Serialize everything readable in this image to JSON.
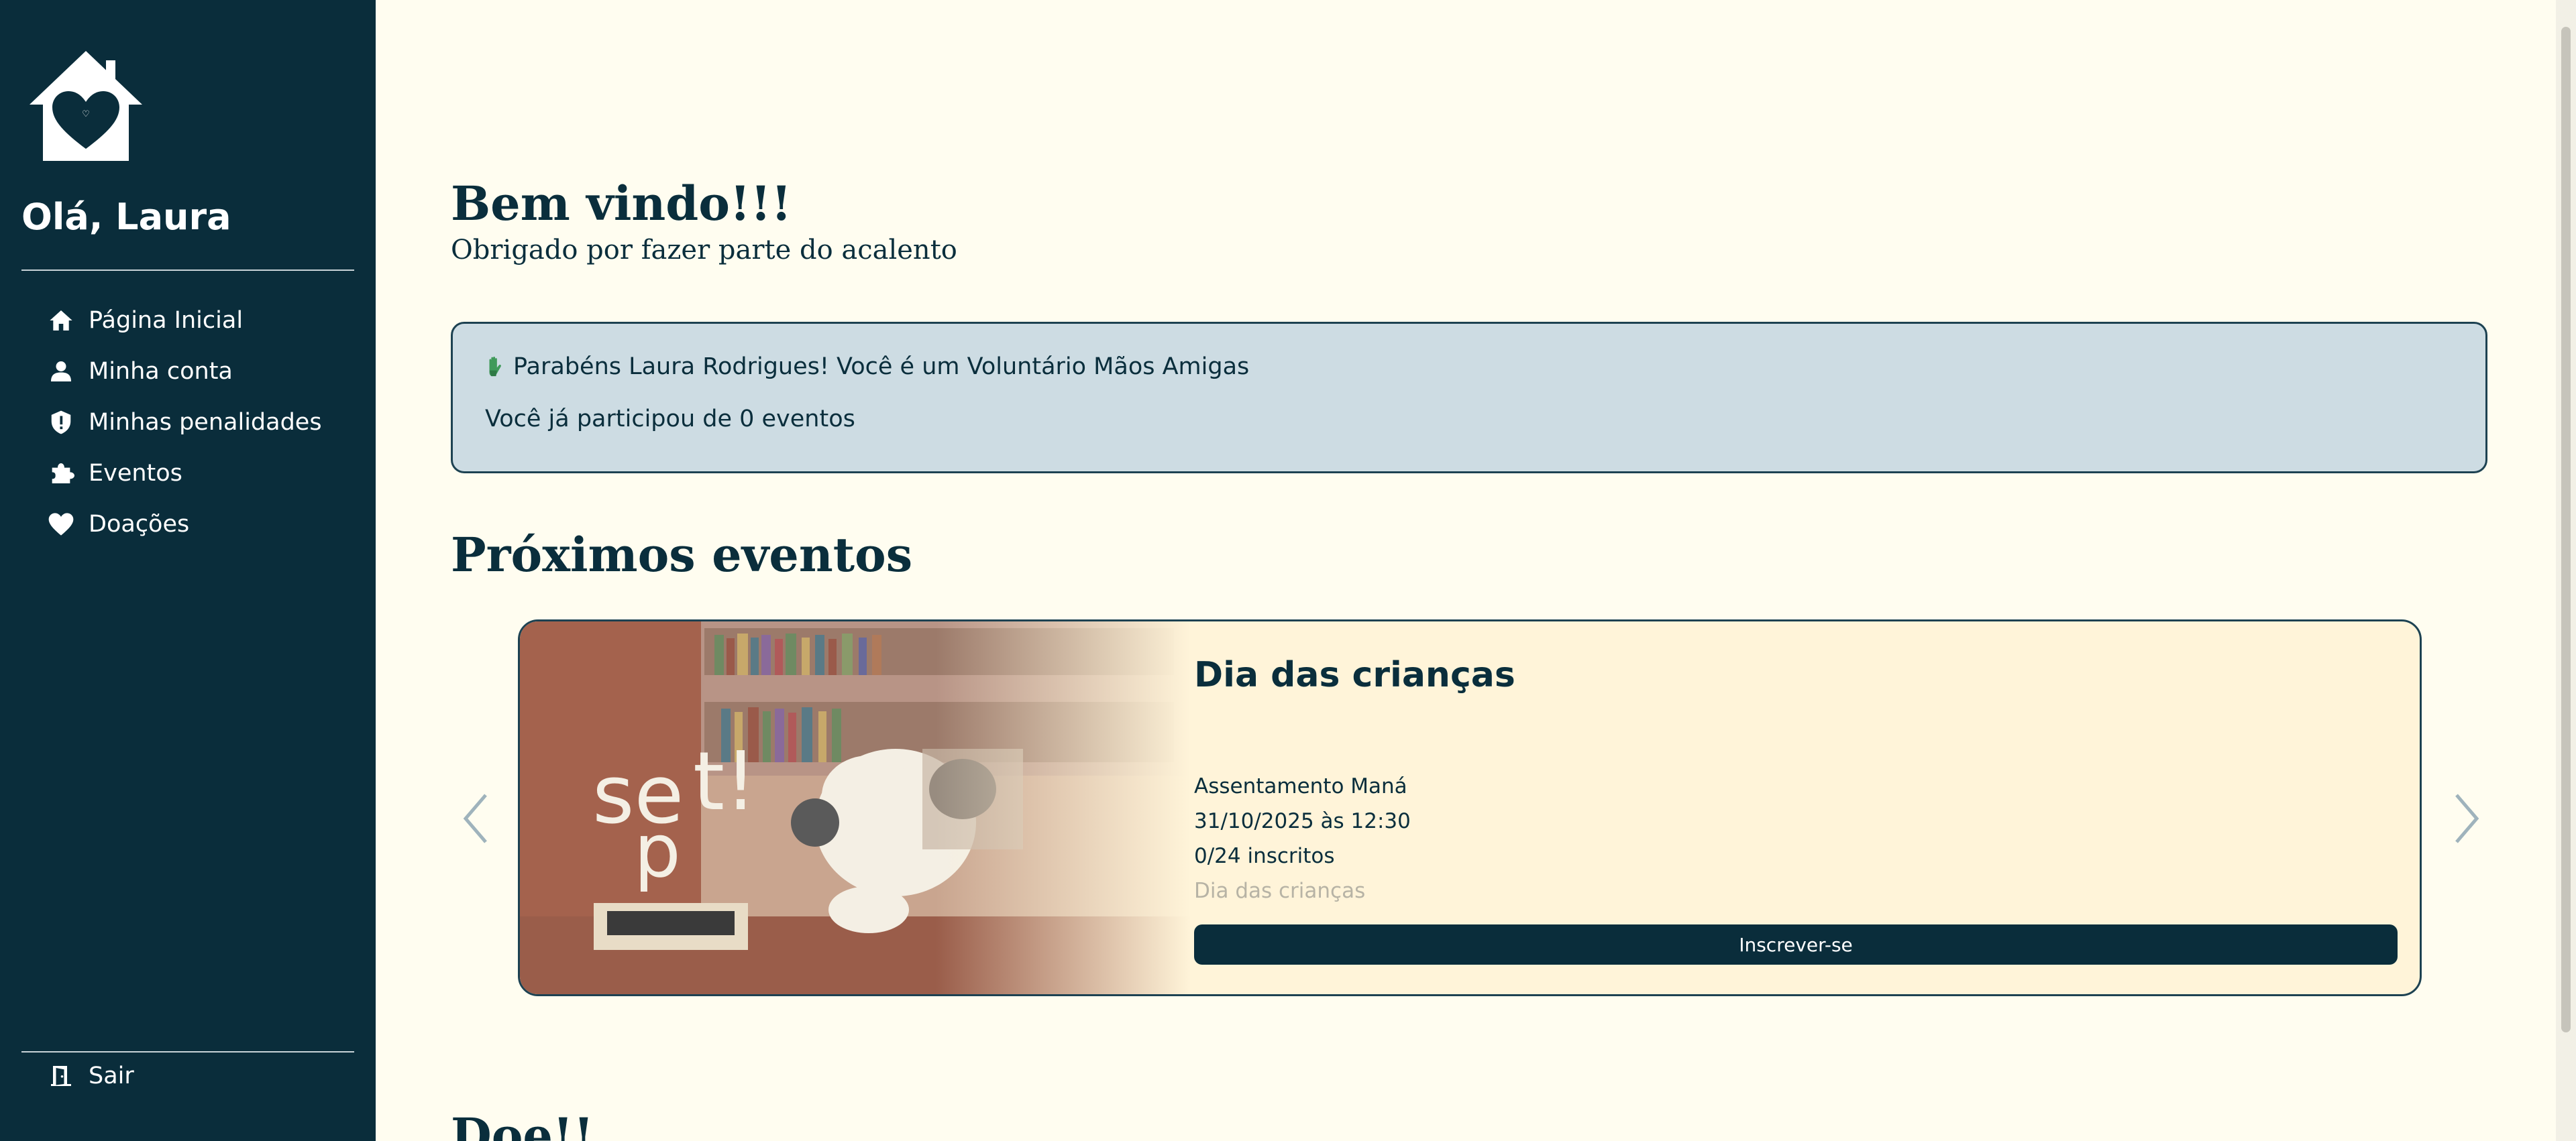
{
  "sidebar": {
    "greeting": "Olá, Laura",
    "items": [
      {
        "label": "Página Inicial",
        "icon": "home-icon"
      },
      {
        "label": "Minha conta",
        "icon": "user-icon"
      },
      {
        "label": "Minhas penalidades",
        "icon": "shield-alert-icon"
      },
      {
        "label": "Eventos",
        "icon": "puzzle-icon"
      },
      {
        "label": "Doações",
        "icon": "heart-icon"
      }
    ],
    "logout_label": "Sair",
    "logout_icon": "door-exit-icon"
  },
  "main": {
    "welcome_title": "Bem vindo!!!",
    "welcome_subtitle": "Obrigado por fazer parte do acalento",
    "notice": {
      "congrats": "Parabéns Laura Rodrigues! Você é um Voluntário Mãos Amigas",
      "participation": "Você já participou de 0 eventos"
    },
    "upcoming_title": "Próximos eventos",
    "event": {
      "title": "Dia das crianças",
      "location": "Assentamento Maná",
      "datetime": "31/10/2025 às 12:30",
      "enrolled": "0/24 inscritos",
      "description": "Dia das crianças",
      "button_label": "Inscrever-se",
      "image_text": "sept!"
    },
    "donate_title": "Doe!!"
  },
  "colors": {
    "sidebar_bg": "#0a2d3b",
    "page_bg": "#fffdf0",
    "notice_bg": "#cddce3",
    "card_bg": "#fff4d9",
    "button_bg": "#0a2d3b"
  }
}
